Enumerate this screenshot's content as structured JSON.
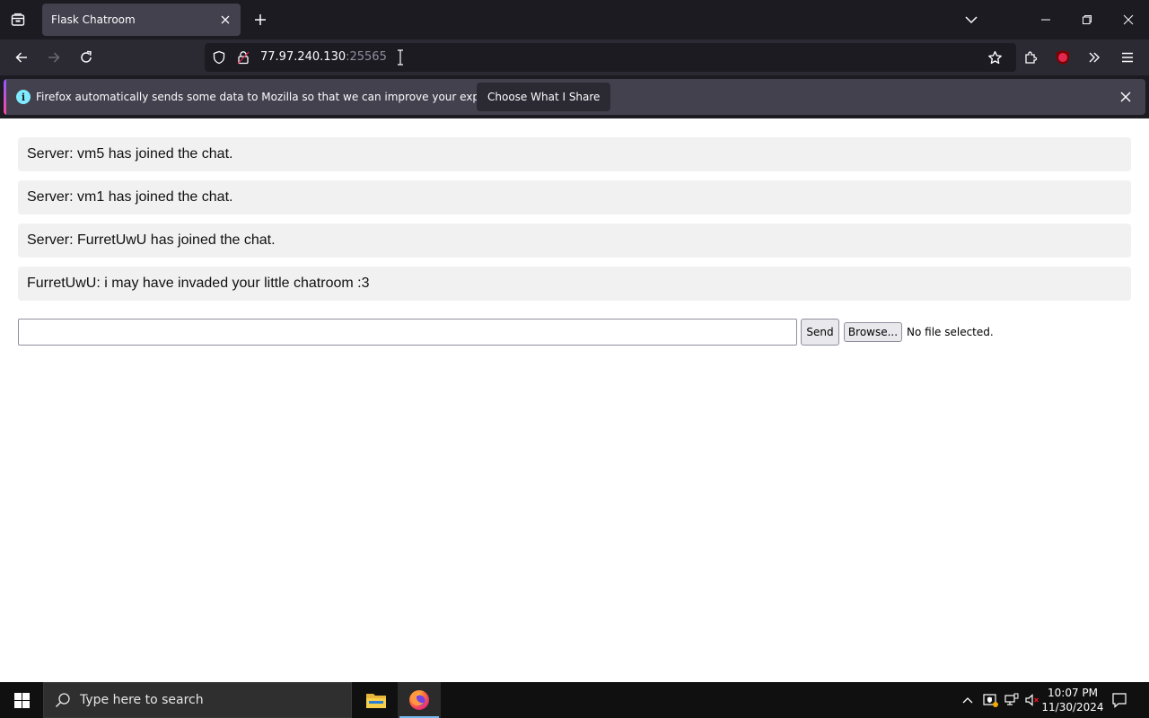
{
  "browser": {
    "tab": {
      "title": "Flask Chatroom"
    },
    "url": {
      "host": "77.97.240.130",
      "port": ":25565"
    },
    "notification": {
      "text": "Firefox automatically sends some data to Mozilla so that we can improve your experience.",
      "button": "Choose What I Share"
    },
    "colors": {
      "chrome_dark": "#1c1b22",
      "toolbar": "#2b2a33",
      "tab_active": "#42414d"
    }
  },
  "chat": {
    "messages": [
      "Server: vm5 has joined the chat.",
      "Server: vm1 has joined the chat.",
      "Server: FurretUwU has joined the chat.",
      "FurretUwU: i may have invaded your little chatroom :3"
    ],
    "input_value": "",
    "send_label": "Send",
    "browse_label": "Browse...",
    "file_status": "No file selected."
  },
  "taskbar": {
    "search_placeholder": "Type here to search",
    "time": "10:07 PM",
    "date": "11/30/2024",
    "pinned": [
      "file-explorer",
      "firefox"
    ]
  }
}
